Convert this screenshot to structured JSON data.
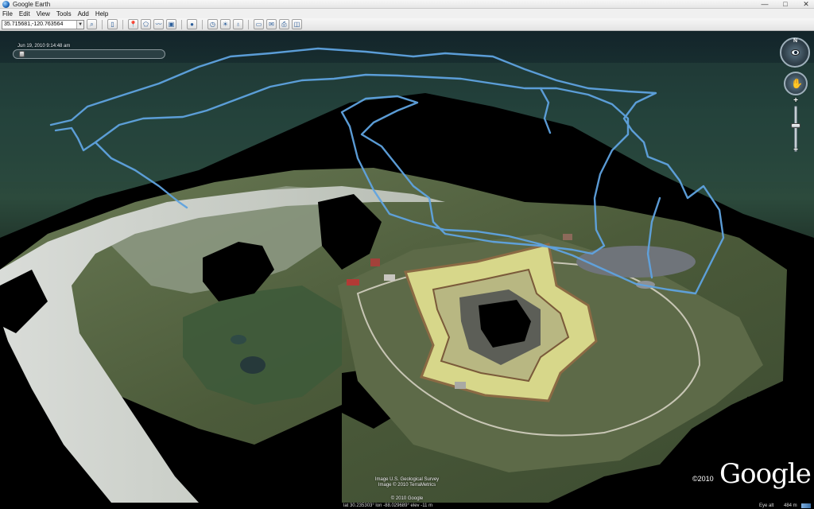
{
  "window": {
    "title": "Google Earth",
    "controls": {
      "minimize": "—",
      "maximize": "□",
      "close": "✕"
    }
  },
  "menu": {
    "items": [
      "File",
      "Edit",
      "View",
      "Tools",
      "Add",
      "Help"
    ]
  },
  "search": {
    "value": "35.715681,-120.763564"
  },
  "toolbar": {
    "buttons": [
      {
        "name": "hide-sidebar-icon",
        "glyph": "▯"
      },
      {
        "name": "add-placemark-icon",
        "glyph": "📍"
      },
      {
        "name": "add-polygon-icon",
        "glyph": "⬠"
      },
      {
        "name": "add-path-icon",
        "glyph": "〰"
      },
      {
        "name": "image-overlay-icon",
        "glyph": "▣"
      },
      {
        "name": "record-tour-icon",
        "glyph": "●"
      },
      {
        "name": "historical-imagery-icon",
        "glyph": "◷"
      },
      {
        "name": "sunlight-icon",
        "glyph": "☀"
      },
      {
        "name": "planets-icon",
        "glyph": "♁"
      },
      {
        "name": "ruler-icon",
        "glyph": "▭"
      },
      {
        "name": "email-icon",
        "glyph": "✉"
      },
      {
        "name": "print-icon",
        "glyph": "⎙"
      },
      {
        "name": "view-in-maps-icon",
        "glyph": "◫"
      }
    ]
  },
  "time_slider": {
    "label": "Jun 19, 2010   9:14:48 am",
    "position": 0.02
  },
  "attribution": {
    "line1": "Image U.S. Geological Survey",
    "line2": "Image © 2010 TerraMetrics",
    "line3": "© 2010 Google",
    "copyright": "©2010",
    "logo": "Google"
  },
  "status": {
    "coords": "lat   30.235303°   lon  -88.029689°   elev  -11 m",
    "eye_alt_label": "Eye alt",
    "eye_alt_value": "484 m"
  },
  "colors": {
    "track": "#5fa3e0",
    "fort_grass": "#d7d78a",
    "water": "#1e3a36"
  },
  "navigation": {
    "north_label": "N",
    "zoom_plus": "+",
    "zoom_minus": "−"
  }
}
